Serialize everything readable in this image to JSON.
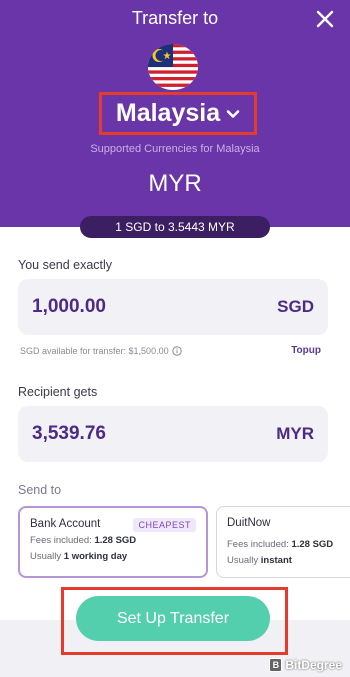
{
  "header": {
    "title": "Transfer to",
    "country": "Malaysia",
    "supported_text": "Supported Currencies for Malaysia",
    "currency": "MYR",
    "rate": "1 SGD to 3.5443 MYR"
  },
  "send": {
    "label": "You send exactly",
    "amount": "1,000.00",
    "currency": "SGD",
    "available": "SGD available for transfer: $1,500.00",
    "topup": "Topup"
  },
  "receive": {
    "label": "Recipient gets",
    "amount": "3,539.76",
    "currency": "MYR"
  },
  "send_to": {
    "label": "Send to",
    "options": [
      {
        "title": "Bank Account",
        "tag": "CHEAPEST",
        "fees_label": "Fees included:",
        "fees_value": "1.28 SGD",
        "time_label": "Usually",
        "time_value": "1 working day"
      },
      {
        "title": "DuitNow",
        "fees_label": "Fees included:",
        "fees_value": "1.28 SGD",
        "time_label": "Usually",
        "time_value": "instant"
      }
    ]
  },
  "cta": {
    "label": "Set Up Transfer"
  },
  "watermark": {
    "text": "BitDegree"
  },
  "icons": {
    "close": "close-icon",
    "chevron": "chevron-down-icon",
    "flag": "malaysia-flag-icon",
    "info": "info-icon"
  },
  "colors": {
    "header_bg": "#6a35a8",
    "accent": "#4d2b85",
    "cta": "#54cfae",
    "highlight": "#e53b2c"
  }
}
